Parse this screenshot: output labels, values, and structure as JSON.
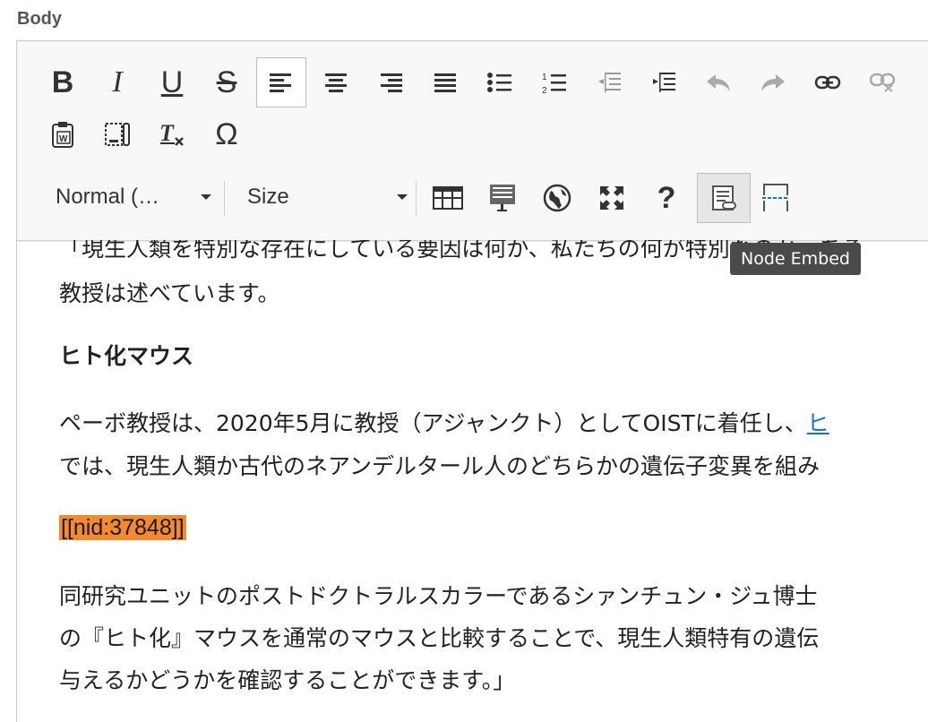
{
  "field": {
    "label": "Body"
  },
  "toolbar": {
    "format_combo": "Normal (…",
    "size_combo": "Size",
    "buttons": [
      "bold",
      "italic",
      "underline",
      "strikethrough",
      "align-left",
      "align-center",
      "align-right",
      "justify",
      "bulleted-list",
      "numbered-list",
      "decrease-indent",
      "increase-indent",
      "undo",
      "redo",
      "link",
      "unlink",
      "paste-from-word",
      "paste-as-text",
      "remove-format",
      "special-character",
      "table",
      "template",
      "language",
      "maximize",
      "help",
      "node-embed",
      "page-break"
    ],
    "bold_glyph": "B",
    "italic_glyph": "I",
    "underline_glyph": "U",
    "strike_glyph": "S",
    "help_glyph": "?",
    "omega_glyph": "Ω"
  },
  "tooltip": {
    "text": "Node Embed"
  },
  "content": {
    "line1": "「現生人類を特別な存在にしている要因は何か、私たちの何が特別なのか、ある",
    "line2": "教授は述べています。",
    "heading": "ヒト化マウス",
    "para2_line1": "ペーボ教授は、2020年5月に教授（アジャンクト）としてOISTに着任し、",
    "para2_link": "ヒ",
    "para2_line2": "では、現生人類か古代のネアンデルタール人のどちらかの遺伝子変異を組み",
    "nid": "[[nid:37848]]",
    "para3_line1": "同研究ユニットのポストドクトラルスカラーであるシァンチュン・ジュ博士",
    "para3_line2": "の『ヒト化』マウスを通常のマウスと比較することで、現生人類特有の遺伝",
    "para3_line3": "与えるかどうかを確認することができます。」"
  }
}
